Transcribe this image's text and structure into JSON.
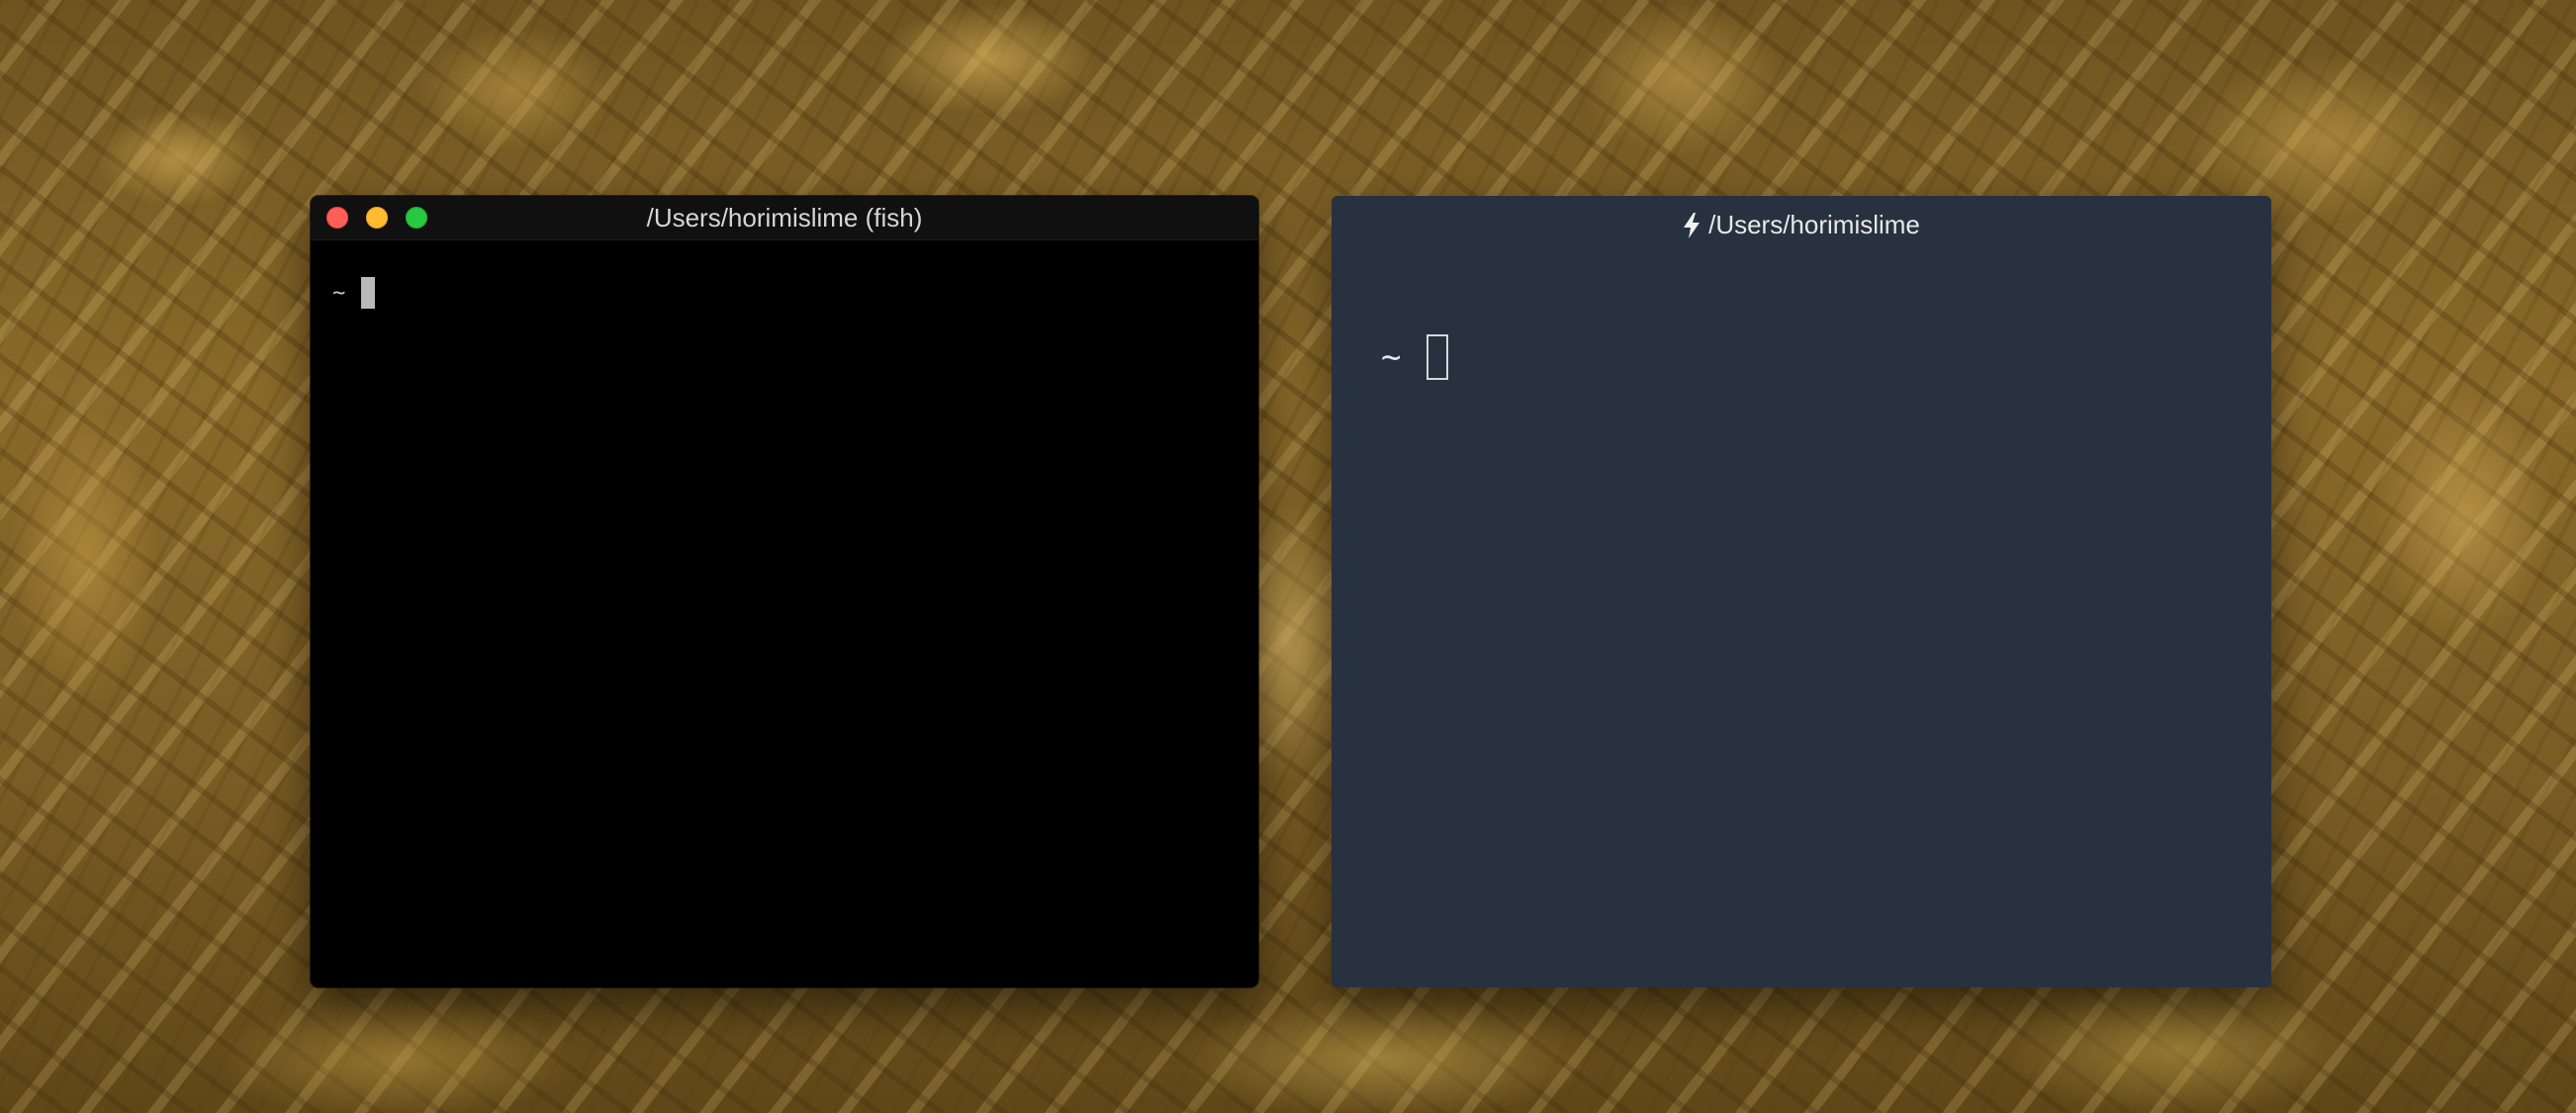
{
  "left_terminal": {
    "title": "/Users/horimislime (fish)",
    "prompt": "~",
    "buttons": {
      "close_color": "#ff5f57",
      "minimize_color": "#febc2e",
      "maximize_color": "#28c840"
    }
  },
  "right_terminal": {
    "title_icon": "lightning-bolt-icon",
    "title": "/Users/horimislime",
    "prompt": "~"
  }
}
